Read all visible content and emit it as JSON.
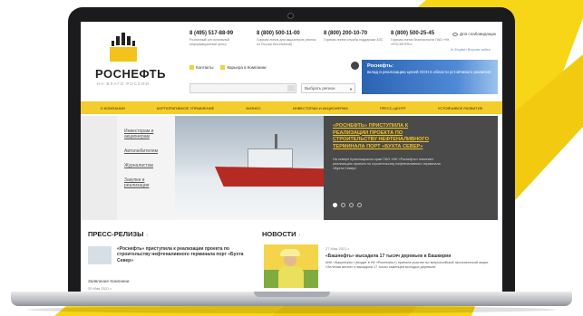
{
  "header": {
    "logo_text": "РОСНЕФТЬ",
    "logo_tagline": "НА БЛАГО РОССИИ",
    "phones": [
      {
        "number": "8 (495) 517-88-99",
        "desc": "Розничный/ региональный информационный центр"
      },
      {
        "number": "8 (800) 500-11-00",
        "desc": "Горячая линия для акционеров (звонок по России бесплатный)"
      },
      {
        "number": "8 (800) 200-10-70",
        "desc": "Горячая линия службы поддержки АЗС"
      },
      {
        "number": "8 (800) 500-25-45",
        "desc": "Горячая линия безопасности ПАО «НК «РОСНЕФТЬ»"
      }
    ],
    "vision_label": "Для слабовидящих",
    "languages": "In English   Версия сайта",
    "links": [
      "Контакты",
      "Карьера в Компании"
    ],
    "region_placeholder": "Выбрать регион",
    "banner": {
      "title": "Роснефть:",
      "text": "вклад в реализацию целей ООН в области устойчивого развития"
    }
  },
  "nav": {
    "items": [
      "О компании",
      "Корпоративное управление",
      "Бизнес",
      "Инвесторам и акционерам",
      "Пресс-центр",
      "Устойчивое развитие"
    ]
  },
  "side_menu": {
    "items": [
      "Инвесторам и акционерам",
      "Автолюбителям",
      "Журналистам",
      "Закупки и реализация"
    ]
  },
  "hero": {
    "title": "«РОСНЕФТЬ» ПРИСТУПИЛА К РЕАЛИЗАЦИИ ПРОЕКТА ПО СТРОИТЕЛЬСТВУ НЕФТЕНАЛИВНОГО ТЕРМИНАЛА ПОРТ «БУХТА СЕВЕР»",
    "text": "На севере Красноярского края ПАО «НК «Роснефть» начинает реализацию проекта по строительству нефтеналивного терминала «Бухта Север»"
  },
  "press": {
    "title": "ПРЕСС-РЕЛИЗЫ",
    "headline": "«Роснефть» приступила к реализации проекта по строительству нефтеналивного терминала порт «Бухта Север»",
    "sub": "Заявление Компании",
    "date": "25 Мая 2021 г."
  },
  "news": {
    "title": "НОВОСТИ",
    "date": "27 Мая 2021 г.",
    "headline": "«Башнефть» высадила 17 тысяч деревьев в Башкирии",
    "text": "АНК «Башнефть» (входит в НК «Роснефть») приняла участие во всероссийской экологической акции «Зеленая весна» и высадила 17 тысяч саженцев молодых деревьев"
  },
  "colors": {
    "brand_yellow": "#f4cc2b",
    "hero_panel": "#4a4a4a",
    "hero_title": "#f4c21c",
    "banner_blue": "#2b63b3"
  }
}
